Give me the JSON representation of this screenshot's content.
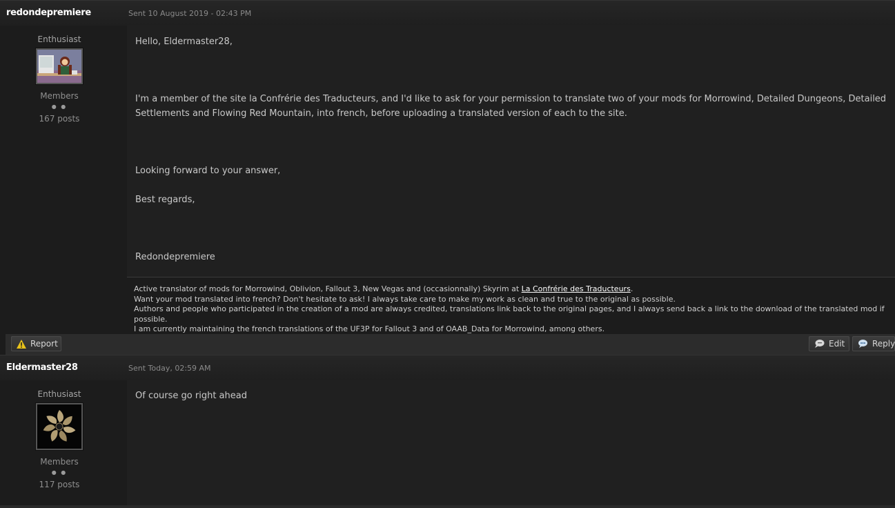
{
  "posts": [
    {
      "author": "redondepremiere",
      "date": "Sent 10 August 2019 - 02:43 PM",
      "title": "Enthusiast",
      "group": "Members",
      "pips": "● ●",
      "post_count": "167 posts",
      "message": [
        "Hello, Eldermaster28,",
        "I'm a member of the site la Confrérie des Traducteurs, and I'd like to ask for your permission to translate two of your mods for Morrowind, Detailed Dungeons, Detailed Settlements and Flowing Red Mountain, into french, before uploading a translated version of each to the site.",
        "Looking forward to your answer,",
        "Best regards,",
        "Redondepremiere"
      ],
      "signature": {
        "line1_prefix": "Active translator of mods for Morrowind, Oblivion, Fallout 3, New Vegas and (occasionnally) Skyrim  at ",
        "line1_link": "La Confrérie des Traducteurs",
        "line1_suffix": ".",
        "line2": "Want your mod translated into french? Don't hesitate to ask! I always take care to make my work as clean and true to the original as possible.",
        "line3": "Authors and people who participated in the creation of a mod are always credited, translations link back to the original pages, and I always send back a link to the download of the translated mod if possible.",
        "line4": "I am currently maintaining the french translations of the UF3P for Fallout 3 and of OAAB_Data for Morrowind, among others."
      },
      "actions": {
        "report": "Report",
        "edit": "Edit",
        "reply": "Reply"
      }
    },
    {
      "author": "Eldermaster28",
      "date": "Sent Today, 02:59 AM",
      "title": "Enthusiast",
      "group": "Members",
      "pips": "● ●",
      "post_count": "117 posts",
      "message": [
        "Of course go right ahead"
      ]
    }
  ],
  "icons": {
    "report": "warning-icon",
    "edit": "speech-bubble-icon",
    "reply": "reply-bubble-icon"
  },
  "colors": {
    "background": "#1c1c1c",
    "text": "#c9c9c9",
    "author": "#ffffff",
    "warning": "#e8c21a"
  }
}
